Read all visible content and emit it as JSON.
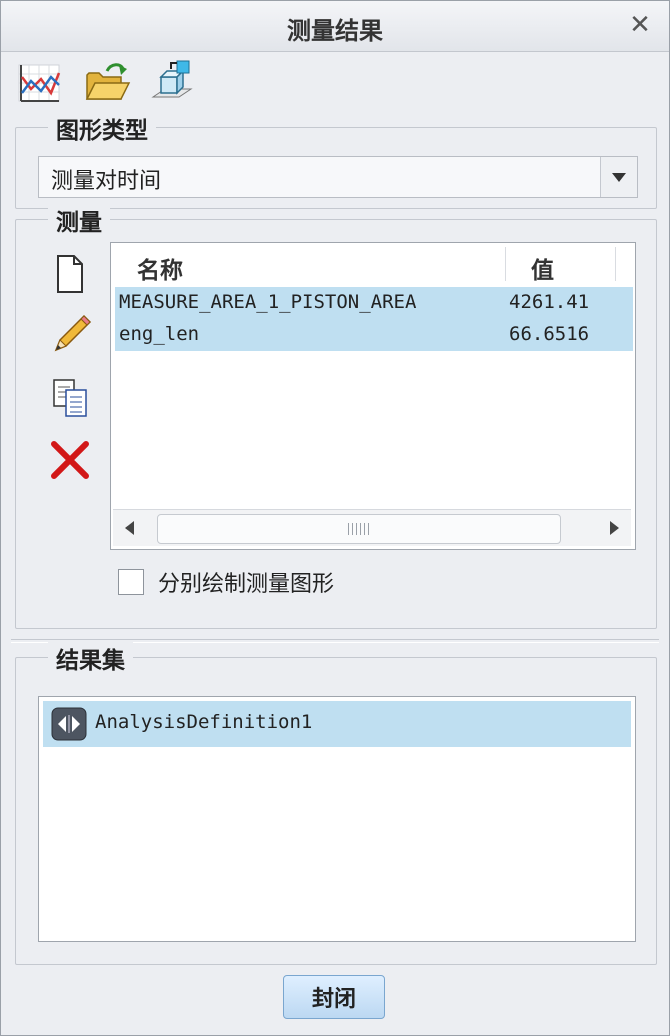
{
  "dialog": {
    "title": "测量结果"
  },
  "graph_type": {
    "label": "图形类型",
    "selected": "测量对时间"
  },
  "measure": {
    "label": "测量",
    "columns": [
      "名称",
      "值"
    ],
    "rows": [
      {
        "name": "MEASURE_AREA_1_PISTON_AREA",
        "value": "4261.41"
      },
      {
        "name": "eng_len",
        "value": "66.6516"
      }
    ],
    "separate_plot_label": "分别绘制测量图形"
  },
  "result_sets": {
    "label": "结果集",
    "items": [
      {
        "name": "AnalysisDefinition1"
      }
    ]
  },
  "buttons": {
    "close_label": "封闭"
  },
  "colors": {
    "selection": "#bfdff1",
    "accent": "#bcd8f2",
    "delete": "#d21818"
  }
}
